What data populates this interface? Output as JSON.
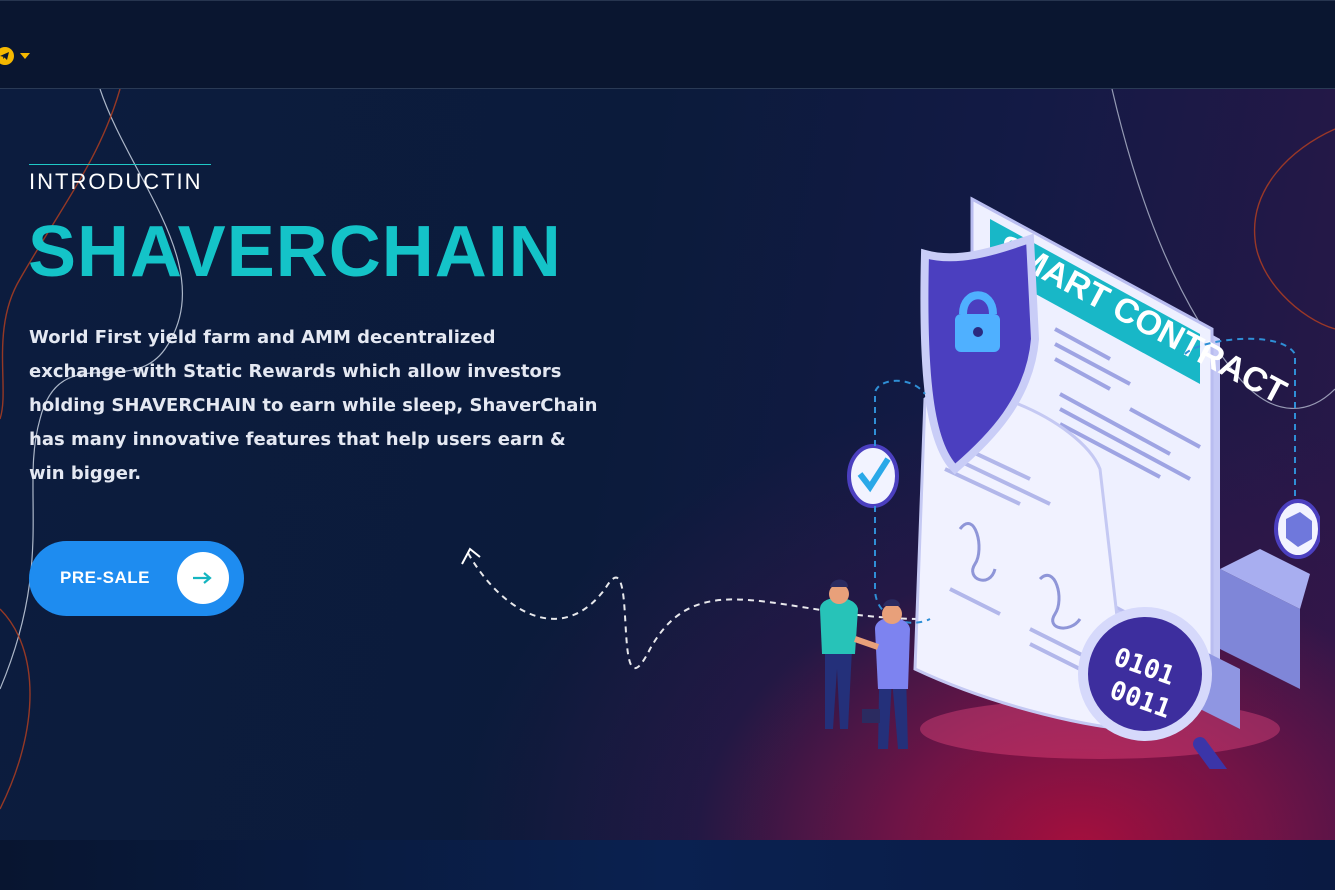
{
  "header": {
    "language_icon": "telegram-icon",
    "dropdown_icon": "caret-down-icon",
    "accent_color": "#f5b800"
  },
  "hero": {
    "intro_label": "INTRODUCTIN",
    "title": "SHAVERCHAIN",
    "description": "World First yield farm and AMM decentralized exchange with Static Rewards which allow investors holding SHAVERCHAIN to earn while sleep, ShaverChain has many innovative features that help users earn & win bigger.",
    "cta": {
      "label": "PRE-SALE",
      "icon": "arrow-right-icon"
    },
    "title_color": "#14c3c8",
    "cta_color": "#1e8cf0"
  },
  "illustration": {
    "banner_text": "SMART CONTRACT",
    "binary_line_1": "0101",
    "binary_line_2": "0011"
  }
}
